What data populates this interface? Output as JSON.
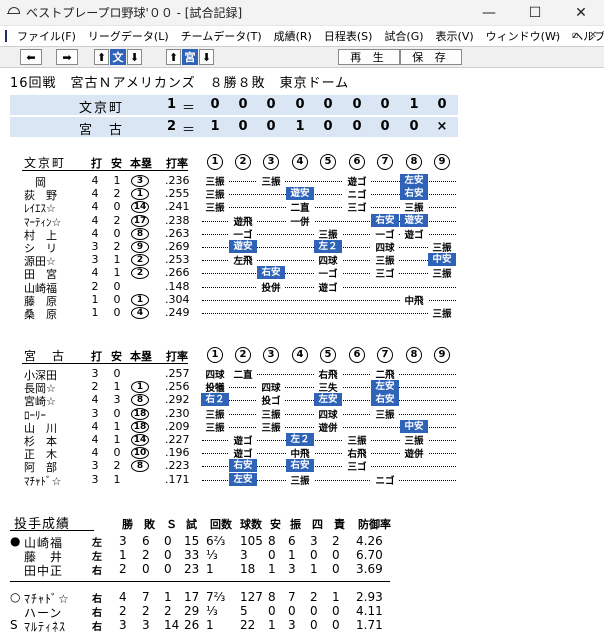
{
  "window": {
    "title": "ベストプレープロ野球'００ - [試合記録]",
    "controls": [
      "—",
      "☐",
      "✕"
    ]
  },
  "menu": {
    "items": [
      "ファイル(F)",
      "リーグデータ(L)",
      "チームデータ(T)",
      "成績(R)",
      "日程表(S)",
      "試合(G)",
      "表示(V)",
      "ウィンドウ(W)",
      "ヘルプ(H)"
    ],
    "mdi": [
      "–",
      "▫",
      "✕"
    ]
  },
  "toolbar": {
    "left": "⬅",
    "right": "➡",
    "up1": "⬆",
    "team1": "文",
    "down1": "⬇",
    "up2": "⬆",
    "team2": "宮",
    "down2": "⬇",
    "play": "再 生",
    "save": "保 存"
  },
  "game_info": "16回戦　宮古Ｎアメリカンズ　８勝８敗　東京ドーム",
  "scoreboard": [
    {
      "team": "文京町",
      "total": "1",
      "eq": "＝",
      "innings": [
        "0",
        "0",
        "0",
        "0",
        "0",
        "0",
        "0",
        "1",
        "0"
      ]
    },
    {
      "team": "宮　古",
      "total": "2",
      "eq": "＝",
      "innings": [
        "1",
        "0",
        "0",
        "1",
        "0",
        "0",
        "0",
        "0",
        "×"
      ]
    }
  ],
  "headers": {
    "ab": "打",
    "h": "安",
    "hr": "本塁",
    "avg": "打率",
    "innings": [
      "1",
      "2",
      "3",
      "4",
      "5",
      "6",
      "7",
      "8",
      "9"
    ]
  },
  "teams": [
    {
      "name": "文京町",
      "batters": [
        {
          "name": "　岡",
          "ab": "4",
          "h": "1",
          "hr": "3",
          "avg": ".236",
          "res": [
            "三振",
            "",
            "三振",
            "",
            "",
            "遊ゴ",
            "",
            "左安",
            ""
          ]
        },
        {
          "name": "荻　野",
          "ab": "4",
          "h": "2",
          "hr": "1",
          "avg": ".255",
          "res": [
            "三振",
            "",
            "",
            "遊安",
            "",
            "ニゴ",
            "",
            "右安",
            ""
          ]
        },
        {
          "name": "ﾚｲｴｽ☆",
          "ab": "4",
          "h": "0",
          "hr": "14",
          "avg": ".241",
          "res": [
            "三振",
            "",
            "",
            "二直",
            "",
            "三ゴ",
            "",
            "三振",
            ""
          ]
        },
        {
          "name": "ﾏｰﾃｨﾝ☆",
          "ab": "4",
          "h": "2",
          "hr": "17",
          "avg": ".238",
          "res": [
            "",
            "遊飛",
            "",
            "一併",
            "",
            "",
            "右安",
            "遊安",
            ""
          ]
        },
        {
          "name": "村　上",
          "ab": "4",
          "h": "0",
          "hr": "8",
          "avg": ".263",
          "res": [
            "",
            "一ゴ",
            "",
            "",
            "三振",
            "",
            "一ゴ",
            "遊ゴ",
            ""
          ]
        },
        {
          "name": "シ　リ",
          "ab": "3",
          "h": "2",
          "hr": "9",
          "avg": ".269",
          "res": [
            "",
            "遊安",
            "",
            "",
            "左２",
            "",
            "四球",
            "",
            "三振"
          ]
        },
        {
          "name": "源田☆",
          "ab": "3",
          "h": "1",
          "hr": "2",
          "avg": ".253",
          "res": [
            "",
            "左飛",
            "",
            "",
            "四球",
            "",
            "三振",
            "",
            "中安"
          ]
        },
        {
          "name": "田　宮",
          "ab": "4",
          "h": "1",
          "hr": "2",
          "avg": ".266",
          "res": [
            "",
            "",
            "右安",
            "",
            "一ゴ",
            "",
            "三ゴ",
            "",
            "三振"
          ]
        },
        {
          "name": "山崎福",
          "ab": "2",
          "h": "0",
          "hr": "",
          "avg": ".148",
          "res": [
            "",
            "",
            "投併",
            "",
            "遊ゴ",
            "",
            "",
            "",
            ""
          ]
        },
        {
          "name": "藤　原",
          "ab": "1",
          "h": "0",
          "hr": "1",
          "avg": ".304",
          "res": [
            "",
            "",
            "",
            "",
            "",
            "",
            "",
            "中飛",
            ""
          ]
        },
        {
          "name": "桑　原",
          "ab": "1",
          "h": "0",
          "hr": "4",
          "avg": ".249",
          "res": [
            "",
            "",
            "",
            "",
            "",
            "",
            "",
            "",
            "三振"
          ]
        }
      ]
    },
    {
      "name": "宮　古",
      "batters": [
        {
          "name": "小深田",
          "ab": "3",
          "h": "0",
          "hr": "",
          "avg": ".257",
          "res": [
            "四球",
            "二直",
            "",
            "",
            "右飛",
            "",
            "二飛",
            "",
            ""
          ]
        },
        {
          "name": "長岡☆",
          "ab": "2",
          "h": "1",
          "hr": "1",
          "avg": ".256",
          "res": [
            "投犠",
            "",
            "四球",
            "",
            "三失",
            "",
            "左安",
            "",
            ""
          ]
        },
        {
          "name": "宮崎☆",
          "ab": "4",
          "h": "3",
          "hr": "8",
          "avg": ".292",
          "res": [
            "右２",
            "",
            "投ゴ",
            "",
            "左安",
            "",
            "右安",
            "",
            ""
          ]
        },
        {
          "name": "ﾛｰﾘｰ",
          "ab": "3",
          "h": "0",
          "hr": "18",
          "avg": ".230",
          "res": [
            "三振",
            "",
            "三振",
            "",
            "四球",
            "",
            "三振",
            "",
            ""
          ]
        },
        {
          "name": "山　川",
          "ab": "4",
          "h": "1",
          "hr": "18",
          "avg": ".209",
          "res": [
            "三振",
            "",
            "三振",
            "",
            "遊併",
            "",
            "",
            "中安",
            ""
          ]
        },
        {
          "name": "杉　本",
          "ab": "4",
          "h": "1",
          "hr": "14",
          "avg": ".227",
          "res": [
            "",
            "遊ゴ",
            "",
            "左２",
            "",
            "三振",
            "",
            "三振",
            ""
          ]
        },
        {
          "name": "正　木",
          "ab": "4",
          "h": "0",
          "hr": "10",
          "avg": ".196",
          "res": [
            "",
            "遊ゴ",
            "",
            "中飛",
            "",
            "右飛",
            "",
            "遊併",
            ""
          ]
        },
        {
          "name": "阿　部",
          "ab": "3",
          "h": "2",
          "hr": "8",
          "avg": ".223",
          "res": [
            "",
            "右安",
            "",
            "右安",
            "",
            "三ゴ",
            "",
            "",
            ""
          ]
        },
        {
          "name": "ﾏﾁｬﾄﾞ☆",
          "ab": "3",
          "h": "1",
          "hr": "",
          "avg": ".171",
          "res": [
            "",
            "左安",
            "",
            "三振",
            "",
            "",
            "ニゴ",
            "",
            ""
          ]
        }
      ]
    }
  ],
  "pitching": {
    "title": "投手成績",
    "headers": [
      "勝",
      "敗",
      "Ｓ",
      "試",
      "回数",
      "球数",
      "安",
      "振",
      "四",
      "責",
      "防御率"
    ],
    "groups": [
      [
        {
          "mark": "●",
          "name": "山崎福",
          "hand": "左",
          "w": "3",
          "l": "6",
          "s": "0",
          "g": "15",
          "ip": "6⅔",
          "np": "105",
          "h": "8",
          "so": "6",
          "bb": "3",
          "er": "2",
          "era": "4.26"
        },
        {
          "mark": "",
          "name": "藤　井",
          "hand": "左",
          "w": "1",
          "l": "2",
          "s": "0",
          "g": "33",
          "ip": "⅓",
          "np": "3",
          "h": "0",
          "so": "1",
          "bb": "0",
          "er": "0",
          "era": "6.70"
        },
        {
          "mark": "",
          "name": "田中正",
          "hand": "右",
          "w": "2",
          "l": "0",
          "s": "0",
          "g": "23",
          "ip": "1",
          "np": "18",
          "h": "1",
          "so": "3",
          "bb": "1",
          "er": "0",
          "era": "3.69"
        }
      ],
      [
        {
          "mark": "○",
          "name": "ﾏﾁｬﾄﾞ☆",
          "hand": "右",
          "w": "4",
          "l": "7",
          "s": "1",
          "g": "17",
          "ip": "7⅔",
          "np": "127",
          "h": "8",
          "so": "7",
          "bb": "2",
          "er": "1",
          "era": "2.93"
        },
        {
          "mark": "",
          "name": "ハーン",
          "hand": "右",
          "w": "2",
          "l": "2",
          "s": "2",
          "g": "29",
          "ip": "⅓",
          "np": "5",
          "h": "0",
          "so": "0",
          "bb": "0",
          "er": "0",
          "era": "4.11"
        },
        {
          "mark": "S",
          "name": "ﾏﾙﾃｨﾈｽ",
          "hand": "右",
          "w": "3",
          "l": "3",
          "s": "14",
          "g": "26",
          "ip": "1",
          "np": "22",
          "h": "1",
          "so": "3",
          "bb": "0",
          "er": "0",
          "era": "1.71"
        }
      ]
    ]
  }
}
